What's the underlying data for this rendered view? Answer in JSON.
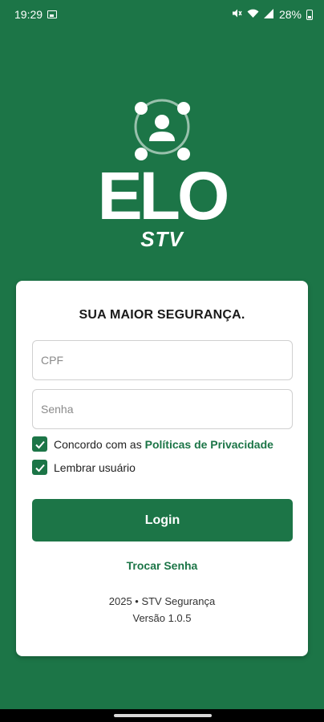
{
  "status_bar": {
    "time": "19:29",
    "battery": "28%",
    "icons": [
      "image-icon",
      "mute-icon",
      "wifi-icon",
      "signal-icon",
      "battery-icon"
    ]
  },
  "logo": {
    "brand": "ELO",
    "sub": "STV",
    "icon": "user-network-icon"
  },
  "card": {
    "title": "SUA MAIOR SEGURANÇA.",
    "cpf_placeholder": "CPF",
    "senha_placeholder": "Senha",
    "agree_prefix": "Concordo com as ",
    "agree_link": "Políticas de Privacidade",
    "agree_checked": true,
    "remember_label": "Lembrar usuário",
    "remember_checked": true,
    "login_label": "Login",
    "change_password": "Trocar Senha",
    "footer_copyright": "2025 • STV Segurança",
    "footer_version": "Versão  1.0.5"
  },
  "colors": {
    "primary": "#1c7547",
    "card_bg": "#ffffff"
  }
}
